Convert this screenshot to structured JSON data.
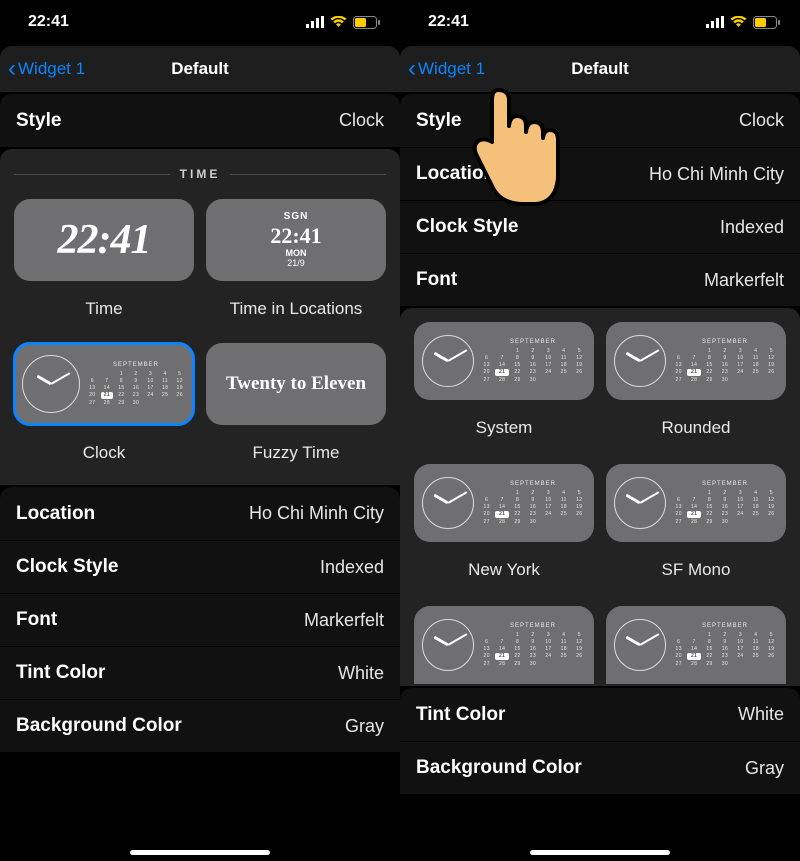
{
  "status": {
    "time": "22:41"
  },
  "left": {
    "back_label": "Widget 1",
    "title": "Default",
    "style": {
      "label": "Style",
      "value": "Clock"
    },
    "time_header": "TIME",
    "previews": {
      "time": {
        "caption": "Time",
        "value": "22:41"
      },
      "time_loc": {
        "caption": "Time in Locations",
        "code": "SGN",
        "value": "22:41",
        "dow": "MON",
        "date": "21/9"
      },
      "clock": {
        "caption": "Clock",
        "month": "SEPTEMBER"
      },
      "fuzzy": {
        "caption": "Fuzzy Time",
        "value": "Twenty to Eleven"
      }
    },
    "rows": {
      "location": {
        "label": "Location",
        "value": "Ho Chi Minh City"
      },
      "clock_style": {
        "label": "Clock Style",
        "value": "Indexed"
      },
      "font": {
        "label": "Font",
        "value": "Markerfelt"
      },
      "tint": {
        "label": "Tint Color",
        "value": "White"
      },
      "bg": {
        "label": "Background Color",
        "value": "Gray"
      }
    }
  },
  "right": {
    "back_label": "Widget 1",
    "title": "Default",
    "rows_top": {
      "style": {
        "label": "Style",
        "value": "Clock"
      },
      "location": {
        "label": "Location",
        "value": "Ho Chi Minh City"
      },
      "clock_style": {
        "label": "Clock Style",
        "value": "Indexed"
      },
      "font": {
        "label": "Font",
        "value": "Markerfelt"
      }
    },
    "font_options": {
      "system": {
        "caption": "System",
        "month": "SEPTEMBER"
      },
      "rounded": {
        "caption": "Rounded",
        "month": "SEPTEMBER"
      },
      "newyork": {
        "caption": "New York",
        "month": "SEPTEMBER"
      },
      "sfmono": {
        "caption": "SF Mono",
        "month": "SEPTEMBER"
      }
    },
    "rows_bottom": {
      "tint": {
        "label": "Tint Color",
        "value": "White"
      },
      "bg": {
        "label": "Background Color",
        "value": "Gray"
      }
    }
  },
  "calendar_days": [
    "",
    "",
    "1",
    "2",
    "3",
    "4",
    "5",
    "6",
    "7",
    "8",
    "9",
    "10",
    "11",
    "12",
    "13",
    "14",
    "15",
    "16",
    "17",
    "18",
    "19",
    "20",
    "21",
    "22",
    "23",
    "24",
    "25",
    "26",
    "27",
    "28",
    "29",
    "30"
  ],
  "calendar_highlight": "21"
}
